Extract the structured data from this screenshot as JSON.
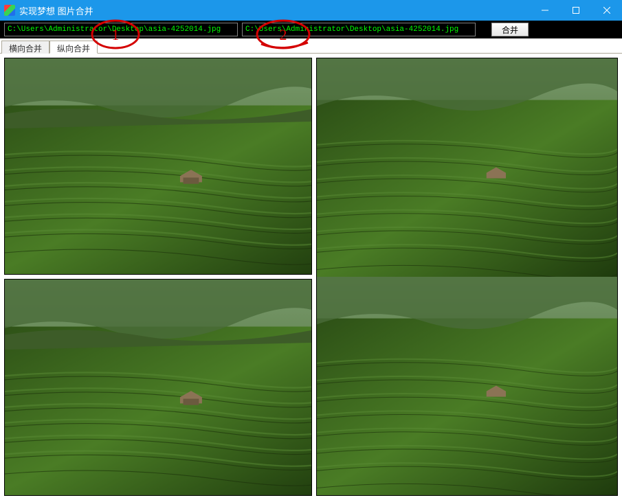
{
  "window": {
    "title": "实现梦想 图片合并"
  },
  "toolbar": {
    "path1": "C:\\Users\\Administrator\\Desktop\\asia-4252014.jpg",
    "path2": "C:\\Users\\Administrator\\Desktop\\asia-4252014.jpg",
    "merge_label": "合并"
  },
  "tabs": {
    "horizontal": "横向合并",
    "vertical": "纵向合并"
  },
  "annotations": {
    "circle1": "1",
    "circle2": "2"
  }
}
